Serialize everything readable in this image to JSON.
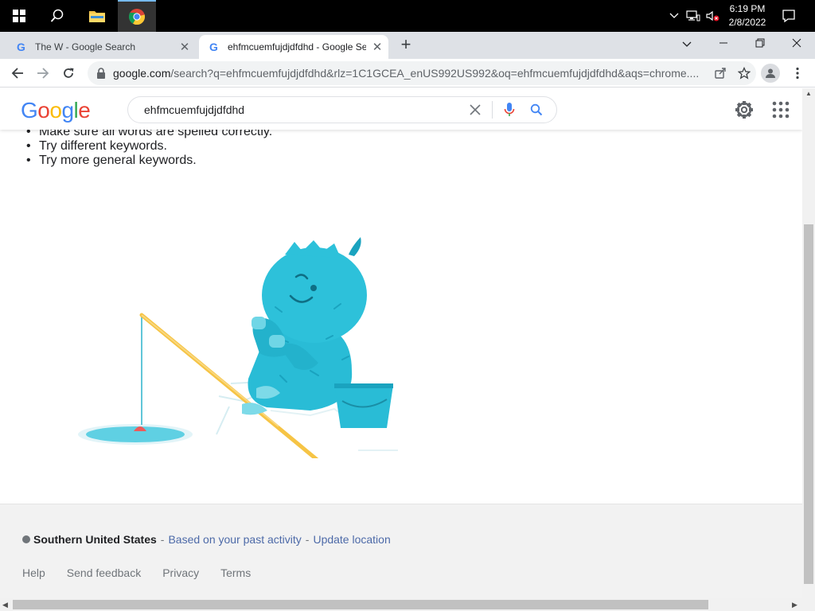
{
  "taskbar": {
    "icons": [
      "windows-start-icon",
      "search-icon",
      "file-explorer-icon",
      "chrome-icon"
    ],
    "tray": {
      "time": "6:19 PM",
      "date": "2/8/2022"
    }
  },
  "tabs": [
    {
      "title": "The W - Google Search",
      "active": false
    },
    {
      "title": "ehfmcuemfujdjdfdhd - Google Se",
      "active": true
    }
  ],
  "omnibox": {
    "host": "google.com",
    "path": "/search?q=ehfmcuemfujdjdfdhd&rlz=1C1GCEA_enUS992US992&oq=ehfmcuemfujdjdfdhd&aqs=chrome...."
  },
  "google": {
    "logo_letters": [
      "G",
      "o",
      "o",
      "g",
      "l",
      "e"
    ],
    "logo_colors": [
      "#4285f4",
      "#ea4335",
      "#fbbc05",
      "#4285f4",
      "#34a853",
      "#ea4335"
    ],
    "search_value": "ehfmcuemfujdjdfdhd",
    "tips": [
      "Make sure all words are spelled correctly.",
      "Try different keywords.",
      "Try more general keywords."
    ]
  },
  "footer": {
    "location": "Southern United States",
    "sep1": " - ",
    "past_activity": "Based on your past activity",
    "sep2": " - ",
    "update_location": "Update location",
    "links": [
      "Help",
      "Send feedback",
      "Privacy",
      "Terms"
    ]
  },
  "colors": {
    "link": "#4d6aa8",
    "yeti": "#29bcd6",
    "yeti_dark": "#1aa3bf",
    "rod": "#f6c445",
    "bobber": "#ee5a5a"
  }
}
